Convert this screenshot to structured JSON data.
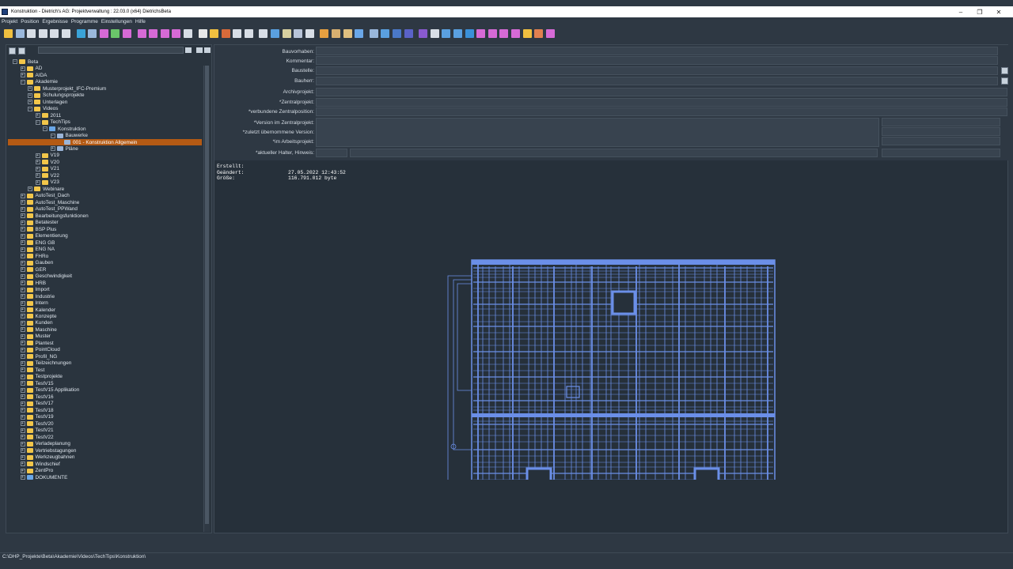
{
  "window": {
    "title": "Konstruktion - Dietrich's AG: Projektverwaltung : 22.03.0 (x64)  DietrichsBeta",
    "minimize": "–",
    "maximize": "❐",
    "close": "✕"
  },
  "menu": [
    "Projekt",
    "Position",
    "Ergebnisse",
    "Programme",
    "Einstellungen",
    "Hilfe"
  ],
  "toolbar_colors": [
    "#f0c040",
    "#9ab8dc",
    "#d8dee6",
    "#d8dee6",
    "#d8dee6",
    "#d8dee6",
    "#3aa3d8",
    "#9ab8dc",
    "#d66ad6",
    "#6ac66a",
    "#d66ad6",
    "#d66ad6",
    "#d66ad6",
    "#d66ad6",
    "#d66ad6",
    "#d8dee6",
    "#e8e8e8",
    "#f0c040",
    "#d86a3a",
    "#d8dee6",
    "#d8dee6",
    "#d8dee6",
    "#5aa0e0",
    "#d8d0a0",
    "#b8c4d8",
    "#d8dee6",
    "#e8a040",
    "#d8b070",
    "#e0c080",
    "#6aa7e8",
    "#9ab8dc",
    "#5aa0e0",
    "#4a78c8",
    "#5a62c8",
    "#8a5ad0",
    "#d8dee6",
    "#5aa0e0",
    "#5aa0e0",
    "#3a90d8",
    "#d66ad6",
    "#d66ad6",
    "#d66ad6",
    "#d66ad6",
    "#f0c040",
    "#e08050",
    "#d66ad6"
  ],
  "tree": [
    {
      "level": 0,
      "label": "Beta",
      "exp": "−",
      "icon": "folder"
    },
    {
      "level": 1,
      "label": "AD",
      "exp": "+",
      "icon": "folder"
    },
    {
      "level": 1,
      "label": "AIDA",
      "exp": "+",
      "icon": "folder"
    },
    {
      "level": 1,
      "label": "Akademie",
      "exp": "−",
      "icon": "folder"
    },
    {
      "level": 2,
      "label": "Musterprojekt_IFC-Premium",
      "exp": "+",
      "icon": "folder"
    },
    {
      "level": 2,
      "label": "Schulungsprojekte",
      "exp": "+",
      "icon": "folder"
    },
    {
      "level": 2,
      "label": "Unterlagen",
      "exp": "+",
      "icon": "folder"
    },
    {
      "level": 2,
      "label": "Videos",
      "exp": "−",
      "icon": "folder"
    },
    {
      "level": 3,
      "label": "2011",
      "exp": "+",
      "icon": "folder"
    },
    {
      "level": 3,
      "label": "TechTips",
      "exp": "−",
      "icon": "folder"
    },
    {
      "level": 4,
      "label": "Konstruktion",
      "exp": "−",
      "icon": "blue"
    },
    {
      "level": 5,
      "label": "Bauwerke",
      "exp": "−",
      "icon": "house"
    },
    {
      "level": 6,
      "label": "001 - Konstruktion Allgemein",
      "exp": "",
      "icon": "house",
      "selected": true
    },
    {
      "level": 5,
      "label": "Pläne",
      "exp": "+",
      "icon": "house"
    },
    {
      "level": 3,
      "label": "V19",
      "exp": "+",
      "icon": "folder"
    },
    {
      "level": 3,
      "label": "V20",
      "exp": "+",
      "icon": "folder"
    },
    {
      "level": 3,
      "label": "V21",
      "exp": "+",
      "icon": "folder"
    },
    {
      "level": 3,
      "label": "V22",
      "exp": "+",
      "icon": "folder"
    },
    {
      "level": 3,
      "label": "V23",
      "exp": "+",
      "icon": "folder"
    },
    {
      "level": 2,
      "label": "Webinare",
      "exp": "+",
      "icon": "folder"
    },
    {
      "level": 1,
      "label": "AutoTest_Dach",
      "exp": "+",
      "icon": "folder"
    },
    {
      "level": 1,
      "label": "AutoTest_Maschine",
      "exp": "+",
      "icon": "folder"
    },
    {
      "level": 1,
      "label": "AutoTest_PPWand",
      "exp": "+",
      "icon": "folder"
    },
    {
      "level": 1,
      "label": "Bearbeitungsfunktionen",
      "exp": "+",
      "icon": "folder"
    },
    {
      "level": 1,
      "label": "Betatester",
      "exp": "+",
      "icon": "folder"
    },
    {
      "level": 1,
      "label": "BSP Plus",
      "exp": "+",
      "icon": "folder"
    },
    {
      "level": 1,
      "label": "Elementierung",
      "exp": "+",
      "icon": "folder"
    },
    {
      "level": 1,
      "label": "ENG GB",
      "exp": "+",
      "icon": "folder"
    },
    {
      "level": 1,
      "label": "ENG NA",
      "exp": "+",
      "icon": "folder"
    },
    {
      "level": 1,
      "label": "FHRo",
      "exp": "+",
      "icon": "folder"
    },
    {
      "level": 1,
      "label": "Gauben",
      "exp": "+",
      "icon": "folder"
    },
    {
      "level": 1,
      "label": "GER",
      "exp": "+",
      "icon": "folder"
    },
    {
      "level": 1,
      "label": "Geschwindigkeit",
      "exp": "+",
      "icon": "folder"
    },
    {
      "level": 1,
      "label": "HRB",
      "exp": "+",
      "icon": "folder"
    },
    {
      "level": 1,
      "label": "Import",
      "exp": "+",
      "icon": "folder"
    },
    {
      "level": 1,
      "label": "Industrie",
      "exp": "+",
      "icon": "folder"
    },
    {
      "level": 1,
      "label": "Intern",
      "exp": "+",
      "icon": "folder"
    },
    {
      "level": 1,
      "label": "Kalender",
      "exp": "+",
      "icon": "folder"
    },
    {
      "level": 1,
      "label": "Konzepte",
      "exp": "+",
      "icon": "folder"
    },
    {
      "level": 1,
      "label": "Kunden",
      "exp": "+",
      "icon": "folder"
    },
    {
      "level": 1,
      "label": "Maschine",
      "exp": "+",
      "icon": "folder"
    },
    {
      "level": 1,
      "label": "Muster",
      "exp": "+",
      "icon": "folder"
    },
    {
      "level": 1,
      "label": "Plantest",
      "exp": "+",
      "icon": "folder"
    },
    {
      "level": 1,
      "label": "PointCloud",
      "exp": "+",
      "icon": "folder"
    },
    {
      "level": 1,
      "label": "Profil_NG",
      "exp": "+",
      "icon": "folder"
    },
    {
      "level": 1,
      "label": "Teilzeichnungen",
      "exp": "+",
      "icon": "folder"
    },
    {
      "level": 1,
      "label": "Test",
      "exp": "+",
      "icon": "folder"
    },
    {
      "level": 1,
      "label": "Testprojekte",
      "exp": "+",
      "icon": "folder"
    },
    {
      "level": 1,
      "label": "TestV15",
      "exp": "+",
      "icon": "folder"
    },
    {
      "level": 1,
      "label": "TestV15 Applikation",
      "exp": "+",
      "icon": "folder"
    },
    {
      "level": 1,
      "label": "TestV16",
      "exp": "+",
      "icon": "folder"
    },
    {
      "level": 1,
      "label": "TestV17",
      "exp": "+",
      "icon": "folder"
    },
    {
      "level": 1,
      "label": "TestV18",
      "exp": "+",
      "icon": "folder"
    },
    {
      "level": 1,
      "label": "TestV19",
      "exp": "+",
      "icon": "folder"
    },
    {
      "level": 1,
      "label": "TestV20",
      "exp": "+",
      "icon": "folder"
    },
    {
      "level": 1,
      "label": "TestV21",
      "exp": "+",
      "icon": "folder"
    },
    {
      "level": 1,
      "label": "TestV22",
      "exp": "+",
      "icon": "folder"
    },
    {
      "level": 1,
      "label": "Verladeplanung",
      "exp": "+",
      "icon": "folder"
    },
    {
      "level": 1,
      "label": "Vertriebstagungen",
      "exp": "+",
      "icon": "folder"
    },
    {
      "level": 1,
      "label": "Werkzeugbahnen",
      "exp": "+",
      "icon": "folder"
    },
    {
      "level": 1,
      "label": "Windschief",
      "exp": "+",
      "icon": "folder"
    },
    {
      "level": 1,
      "label": "ZentPro",
      "exp": "+",
      "icon": "folder"
    },
    {
      "level": 1,
      "label": "DOKUMENTE",
      "exp": "+",
      "icon": "blue"
    }
  ],
  "form": {
    "bauvorhaben_label": "Bauvorhaben:",
    "kommentar_label": "Kommentar:",
    "baustelle_label": "Baustelle:",
    "bauherr_label": "Bauherr:",
    "archivprojekt_label": "Archivprojekt:",
    "zentralprojekt_label": "*Zentralprojekt:",
    "verbundene_label": "*verbundene Zentralposition:",
    "version_label": "*Version im Zentralprojekt:",
    "zuletzt_label": "*zuletzt übernommene Version:",
    "arbeitsprojekt_label": "*im Arbeitsprojekt:",
    "halter_label": "*aktueller Halter, Hinweis:"
  },
  "info": {
    "erstellt_label": "Erstellt:",
    "erstellt_value": "",
    "geaendert_label": "Geändert:",
    "geaendert_value": "27.05.2022 12:43:52",
    "groesse_label": "Größe:",
    "groesse_value": "116.791.012 byte"
  },
  "status": {
    "path": "C:\\DHP_Projekte\\Beta\\Akademie\\Videos\\TechTips\\Konstruktion\\"
  },
  "colors": {
    "background": "#2e3843",
    "selected": "#b45a14",
    "drawing": "#6b8fe8"
  }
}
